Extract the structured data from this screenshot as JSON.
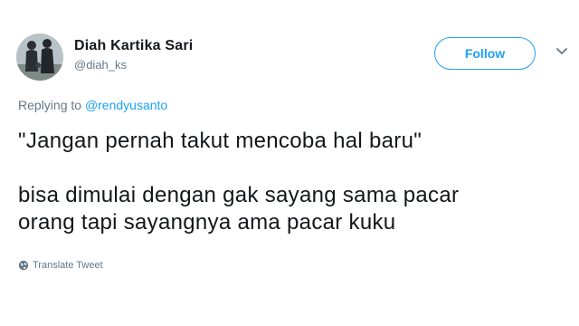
{
  "user": {
    "display_name": "Diah Kartika Sari",
    "handle": "@diah_ks"
  },
  "follow_button": {
    "label": "Follow"
  },
  "reply": {
    "prefix": "Replying to",
    "mention": "@rendyusanto"
  },
  "tweet": {
    "line1": "\"Jangan pernah takut mencoba hal baru\"",
    "line2": "bisa dimulai dengan gak sayang sama pacar",
    "line3": "orang tapi sayangnya ama pacar kuku"
  },
  "translate": {
    "label": "Translate Tweet"
  },
  "colors": {
    "accent": "#1da1f2",
    "text_primary": "#14171a",
    "text_secondary": "#657786"
  },
  "icons": {
    "caret": "chevron-down-icon",
    "translate": "globe-icon"
  }
}
